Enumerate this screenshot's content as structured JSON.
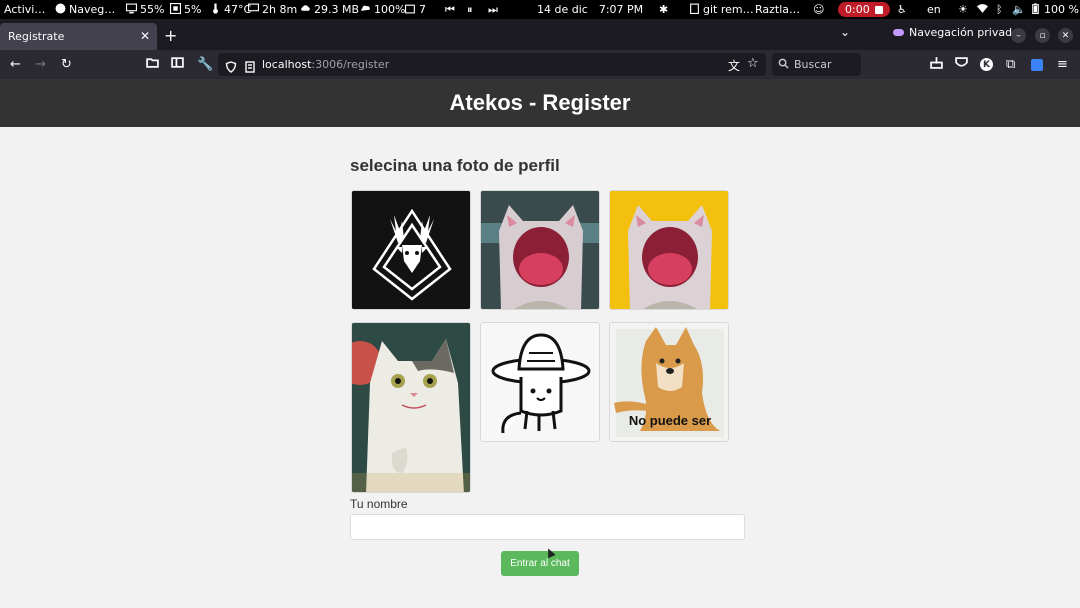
{
  "system_bar": {
    "activities": "Activi…",
    "browser_app": "Naveg…",
    "cpu": "55%",
    "mem": "5%",
    "temp": "47°C",
    "uptime": "2h 8m",
    "download": "29.3 MB",
    "cloud": "100%",
    "workspaces": "7",
    "date": "14 de dic",
    "time": "7:07 PM",
    "git": "git rem…",
    "user": "Raztla…",
    "record_time": "0:00",
    "lang": "en",
    "battery": "100 %"
  },
  "browser": {
    "tab_title": "Registrate",
    "private_label": "Navegación privada",
    "url_host": "localhost",
    "url_rest": ":3006/register",
    "search_placeholder": "Buscar"
  },
  "page": {
    "header": "Atekos - Register",
    "subtitle": "selecina una foto de perfil",
    "profile_pics": [
      {
        "name": "deer-logo"
      },
      {
        "name": "screaming-cat-gray"
      },
      {
        "name": "screaming-cat-yellow"
      },
      {
        "name": "white-cat"
      },
      {
        "name": "mexican-hat-cat"
      },
      {
        "name": "cheems-dog",
        "caption": "No puede ser"
      }
    ],
    "name_label": "Tu nombre",
    "name_value": "",
    "submit_label": "Entrar al chat"
  },
  "colors": {
    "header_bg": "#333333",
    "page_bg": "#f2f2f2",
    "button_green": "#5cb85c",
    "record_red": "#c01c28"
  }
}
